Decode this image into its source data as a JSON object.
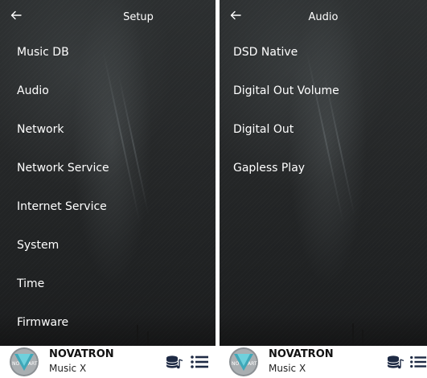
{
  "colors": {
    "screen_bg": "#262829",
    "text": "#ffffff",
    "footer_bg": "#ffffff",
    "footer_text": "#111111"
  },
  "left_panel": {
    "title": "Setup",
    "menu": [
      {
        "label": "Music DB"
      },
      {
        "label": "Audio"
      },
      {
        "label": "Network"
      },
      {
        "label": "Network Service"
      },
      {
        "label": "Internet Service"
      },
      {
        "label": "System"
      },
      {
        "label": "Time"
      },
      {
        "label": "Firmware"
      }
    ],
    "footer": {
      "brand": "NOVATRON",
      "model": "Music X",
      "logo_text_left": "NO",
      "logo_text_right": "ART"
    }
  },
  "right_panel": {
    "title": "Audio",
    "menu": [
      {
        "label": "DSD Native"
      },
      {
        "label": "Digital Out Volume"
      },
      {
        "label": "Digital Out"
      },
      {
        "label": "Gapless Play"
      }
    ],
    "footer": {
      "brand": "NOVATRON",
      "model": "Music X",
      "logo_text_left": "NO",
      "logo_text_right": "ART"
    }
  },
  "icons": {
    "back": "arrow-left-icon",
    "database": "database-music-icon",
    "list": "list-menu-icon",
    "logo": "novatron-logo-icon"
  }
}
